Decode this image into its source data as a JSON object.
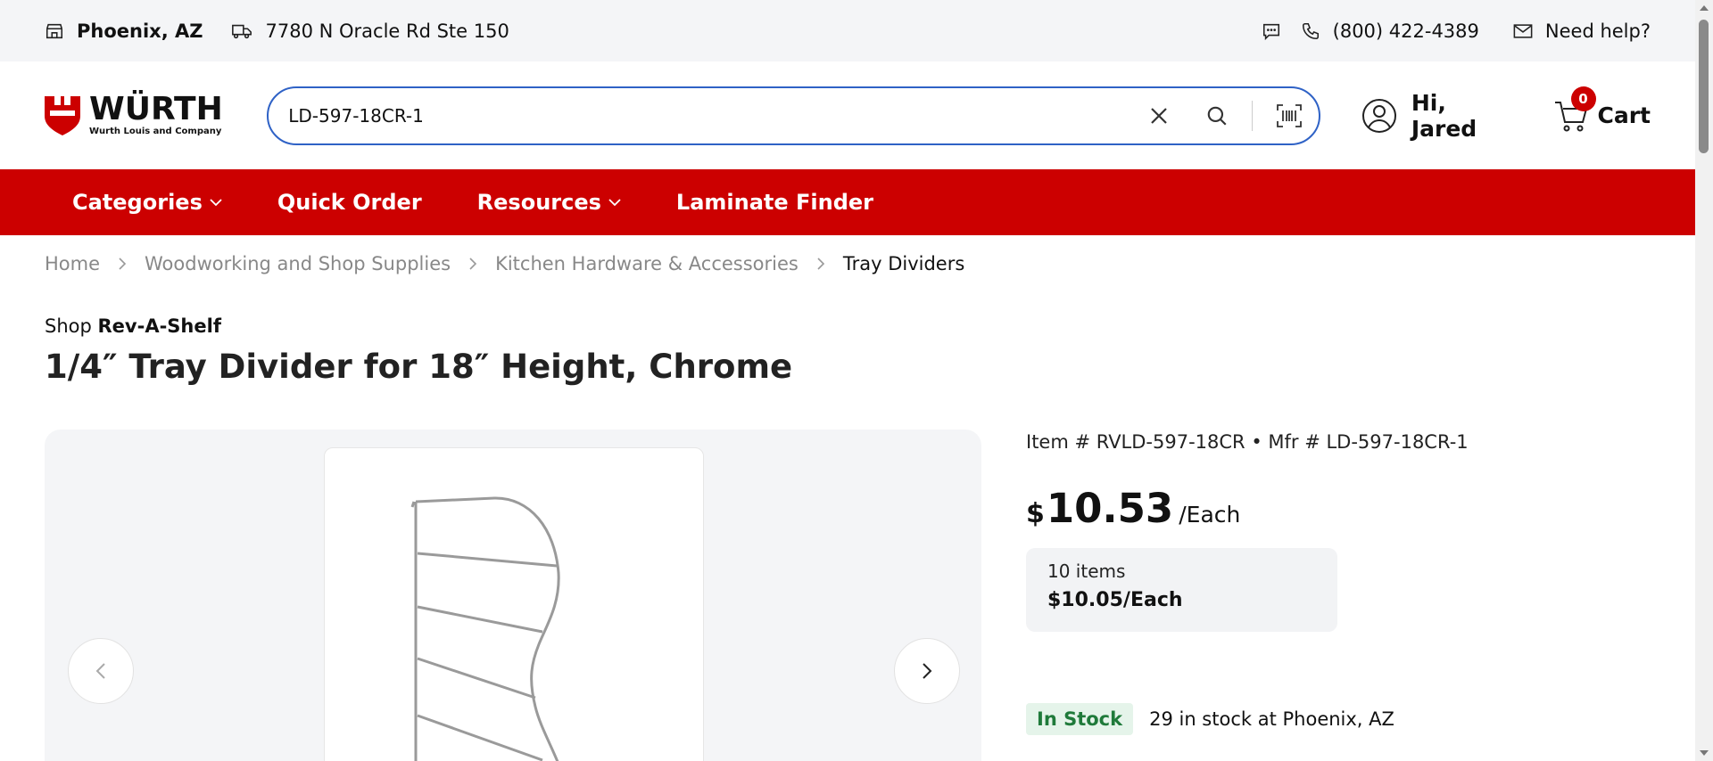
{
  "topbar": {
    "location": "Phoenix, AZ",
    "address": "7780 N Oracle Rd Ste 150",
    "phone": "(800) 422-4389",
    "help": "Need help?"
  },
  "header": {
    "logo_word": "WÜRTH",
    "logo_sub": "Wurth Louis and Company",
    "search_value": "LD-597-18CR-1",
    "account_label": "Hi, Jared",
    "cart_label": "Cart",
    "cart_count": "0"
  },
  "nav": {
    "items": [
      "Categories",
      "Quick Order",
      "Resources",
      "Laminate Finder"
    ]
  },
  "breadcrumb": [
    "Home",
    "Woodworking and Shop Supplies",
    "Kitchen Hardware & Accessories",
    "Tray Dividers"
  ],
  "product": {
    "shop_prefix": "Shop",
    "brand": "Rev-A-Shelf",
    "title": "1/4″ Tray Divider for 18″ Height, Chrome",
    "item_line": "Item # RVLD-597-18CR  •  Mfr # LD-597-18CR-1",
    "currency": "$",
    "price": "10.53",
    "unit": "/Each",
    "tier_qty": "10 items",
    "tier_price": "$10.05",
    "tier_unit": "/Each",
    "stock_badge": "In Stock",
    "stock_text": "29 in stock at Phoenix, AZ"
  },
  "colors": {
    "brand_red": "#cc0000",
    "search_border": "#2f62c6",
    "in_stock_green": "#1f7a3a"
  }
}
